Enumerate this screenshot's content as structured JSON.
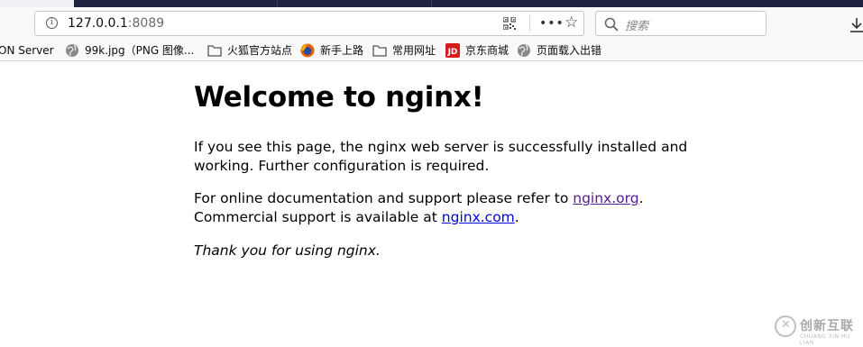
{
  "browser": {
    "url_host": "127.0.0.1",
    "url_port": ":8089",
    "search_placeholder": "搜索",
    "bookmarks": [
      {
        "label": "ON Server",
        "icon": "none"
      },
      {
        "label": "99k.jpg（PNG 图像...",
        "icon": "globe-icon"
      },
      {
        "label": "火狐官方站点",
        "icon": "folder-icon"
      },
      {
        "label": "新手上路",
        "icon": "firefox-icon"
      },
      {
        "label": "常用网址",
        "icon": "folder-icon"
      },
      {
        "label": "京东商城",
        "icon": "jd-icon"
      },
      {
        "label": "页面载入出错",
        "icon": "globe-icon"
      }
    ]
  },
  "page": {
    "title": "Welcome to nginx!",
    "para1_line1": "If you see this page, the nginx web server is successfully installed and",
    "para1_line2": "working. Further configuration is required.",
    "para2_line1_prefix": "For online documentation and support please refer to ",
    "para2_link1": "nginx.org",
    "para2_line1_suffix": ".",
    "para2_line2_prefix": "Commercial support is available at ",
    "para2_link2": "nginx.com",
    "para2_line2_suffix": ".",
    "thanks": "Thank you for using nginx."
  },
  "watermark": {
    "text": "创新互联",
    "sub": "CHUANG XIN HU LIAN"
  },
  "colors": {
    "link": "#0000ee",
    "visited_link": "#551a8b",
    "chrome_bg": "#f9f9fa"
  }
}
